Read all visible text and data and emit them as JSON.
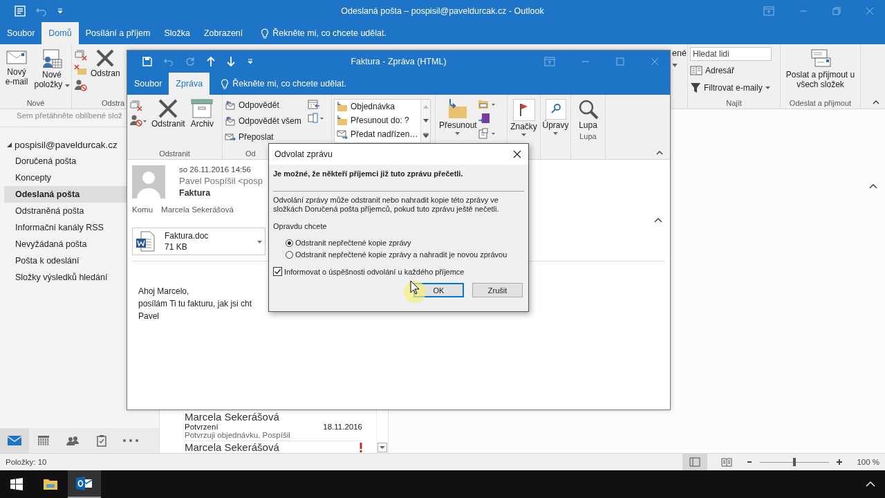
{
  "main_window": {
    "title": "Odeslaná pošta – pospisil@paveldurcak.cz  -  Outlook",
    "tabs": [
      {
        "label": "Soubor",
        "selected": false
      },
      {
        "label": "Domů",
        "selected": true
      },
      {
        "label": "Posílání a příjem",
        "selected": false
      },
      {
        "label": "Složka",
        "selected": false
      },
      {
        "label": "Zobrazení",
        "selected": false
      }
    ],
    "tell_me": "Řekněte mi, co chcete udělat.",
    "ribbon": {
      "new_email": "Nový e-mail",
      "new_items": "Nové položky",
      "group_new": "Nové",
      "delete_cut": "Odstran",
      "group_delete_cut": "Odstra",
      "cut_label": "ené",
      "search_people": {
        "placeholder": "Hledat lidi"
      },
      "address_book": "Adresář",
      "filter_email": "Filtrovat e-maily",
      "group_find": "Najít",
      "send_receive_all": "Poslat a přijmout u všech složek",
      "group_send_receive": "Odeslat a přijmout"
    },
    "folder_pane": {
      "favorites_hint": "Sem přetáhněte oblíbené slož",
      "account": "pospisil@paveldurcak.cz",
      "expanded": true,
      "folders": [
        {
          "name": "Doručená pošta",
          "selected": false
        },
        {
          "name": "Koncepty",
          "selected": false
        },
        {
          "name": "Odeslaná pošta",
          "selected": true
        },
        {
          "name": "Odstraněná pošta",
          "selected": false
        },
        {
          "name": "Informační kanály RSS",
          "selected": false
        },
        {
          "name": "Nevyžádaná pošta",
          "selected": false
        },
        {
          "name": "Pošta k odeslání",
          "selected": false
        },
        {
          "name": "Složky výsledků hledání",
          "selected": false
        }
      ]
    },
    "mail_list": [
      {
        "sender": "Marcela Sekerášová",
        "subject": "Potvrzení",
        "date": "18.11.2016",
        "preview": "Potvrzuji objednávku.  Pospíšil",
        "important": false
      },
      {
        "sender": "Marcela Sekerášová",
        "important": true
      }
    ],
    "nav": [
      {
        "kind": "mail",
        "selected": true
      },
      {
        "kind": "calendar",
        "selected": false
      },
      {
        "kind": "people",
        "selected": false
      },
      {
        "kind": "tasks",
        "selected": false
      },
      {
        "kind": "more",
        "selected": false
      }
    ],
    "status_bar": {
      "items": "Položky: 10",
      "views": [
        {
          "kind": "normal",
          "selected": true
        },
        {
          "kind": "reading",
          "selected": false
        }
      ],
      "zoom_slider": {
        "level": 0.5
      },
      "zoom": "100 %"
    }
  },
  "message_window": {
    "title": "Faktura  -  Zpráva (HTML)",
    "tabs": [
      {
        "label": "Soubor",
        "selected": false
      },
      {
        "label": "Zpráva",
        "selected": true
      }
    ],
    "tell_me": "Řekněte mi, co chcete udělat.",
    "ribbon": {
      "delete": "Odstranit",
      "archive": "Archiv",
      "group_delete": "Odstranit",
      "reply": "Odpovědět",
      "reply_all": "Odpovědět všem",
      "forward": "Přeposlat",
      "group_respond_cut": "Od",
      "quick_steps": [
        "Objednávka",
        "Přesunout do: ?",
        "Předat nadřízen…"
      ],
      "move": "Přesunout",
      "tags": "Značky",
      "editing": "Úpravy",
      "zoom": "Lupa",
      "group_zoom": "Lupa"
    },
    "header": {
      "date": "so 26.11.2016 14:56",
      "sender": "Pavel Pospíšil <posp",
      "subject": "Faktura",
      "to_label": "Komu",
      "to": "Marcela Sekerášová"
    },
    "attachment": {
      "name": "Faktura.doc",
      "size": "71 KB"
    },
    "body": [
      "Ahoj Marcelo,",
      "posílám Ti tu fakturu, jak jsi cht",
      "Pavel"
    ]
  },
  "dialog": {
    "title": "Odvolat zprávu",
    "warning": "Je možné, že někteří příjemci již tuto zprávu přečetli.",
    "info": "Odvolání zprávy může odstranit nebo nahradit kopie této zprávy ve složkách Doručená pošta příjemců, pokud tuto zprávu ještě nečetli.",
    "question": "Opravdu chcete",
    "options": [
      {
        "label": "Odstranit nepřečtené kopie zprávy",
        "selected": true
      },
      {
        "label": "Odstranit nepřečtené kopie zprávy a nahradit je novou zprávou",
        "selected": false
      }
    ],
    "notify": {
      "label": "Informovat o úspěšnosti odvolání u každého příjemce",
      "checked": true
    },
    "buttons": [
      {
        "label": "OK",
        "default": true
      },
      {
        "label": "Zrušit",
        "default": false
      }
    ]
  },
  "taskbar": [
    {
      "kind": "start",
      "selected": false
    },
    {
      "kind": "explorer",
      "selected": false
    },
    {
      "kind": "outlook",
      "selected": true
    }
  ]
}
